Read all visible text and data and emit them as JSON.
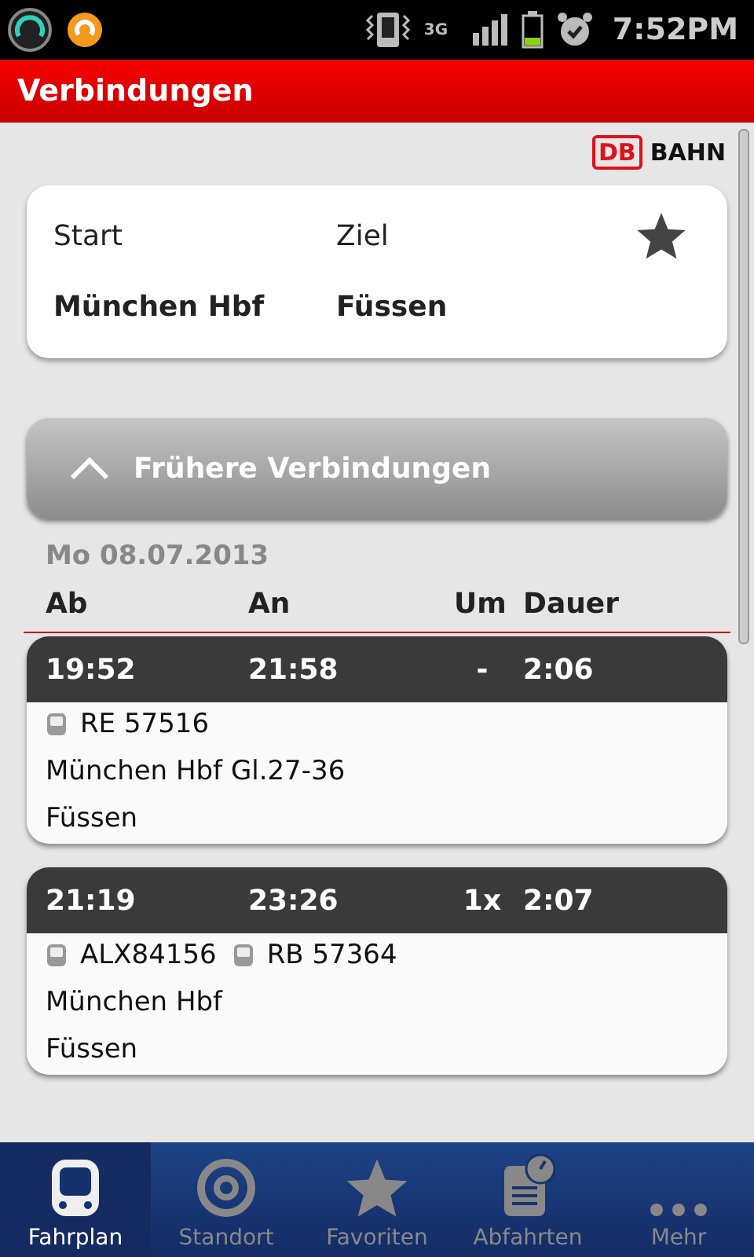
{
  "status_bar": {
    "network": "3G",
    "time": "7:52PM"
  },
  "header": {
    "title": "Verbindungen"
  },
  "logo": {
    "mark": "DB",
    "word": "BAHN"
  },
  "route": {
    "start_label": "Start",
    "start": "München Hbf",
    "destination_label": "Ziel",
    "destination": "Füssen"
  },
  "earlier_button": {
    "label": "Frühere Verbindungen"
  },
  "date": "Mo 08.07.2013",
  "columns": [
    "Ab",
    "An",
    "Um",
    "Dauer"
  ],
  "connections": [
    {
      "departure": "19:52",
      "arrival": "21:58",
      "changes": "-",
      "duration": "2:06",
      "trains": [
        "RE 57516"
      ],
      "from": "München Hbf Gl.27-36",
      "to": "Füssen"
    },
    {
      "departure": "21:19",
      "arrival": "23:26",
      "changes": "1x",
      "duration": "2:07",
      "trains": [
        "ALX84156",
        "RB 57364"
      ],
      "from": "München Hbf",
      "to": "Füssen"
    }
  ],
  "nav": [
    {
      "kind": "train",
      "label": "Fahrplan",
      "selected": true
    },
    {
      "kind": "target",
      "label": "Standort",
      "selected": false
    },
    {
      "kind": "star",
      "label": "Favoriten",
      "selected": false
    },
    {
      "kind": "departures",
      "label": "Abfahrten",
      "selected": false
    },
    {
      "kind": "more",
      "label": "Mehr",
      "selected": false
    }
  ]
}
